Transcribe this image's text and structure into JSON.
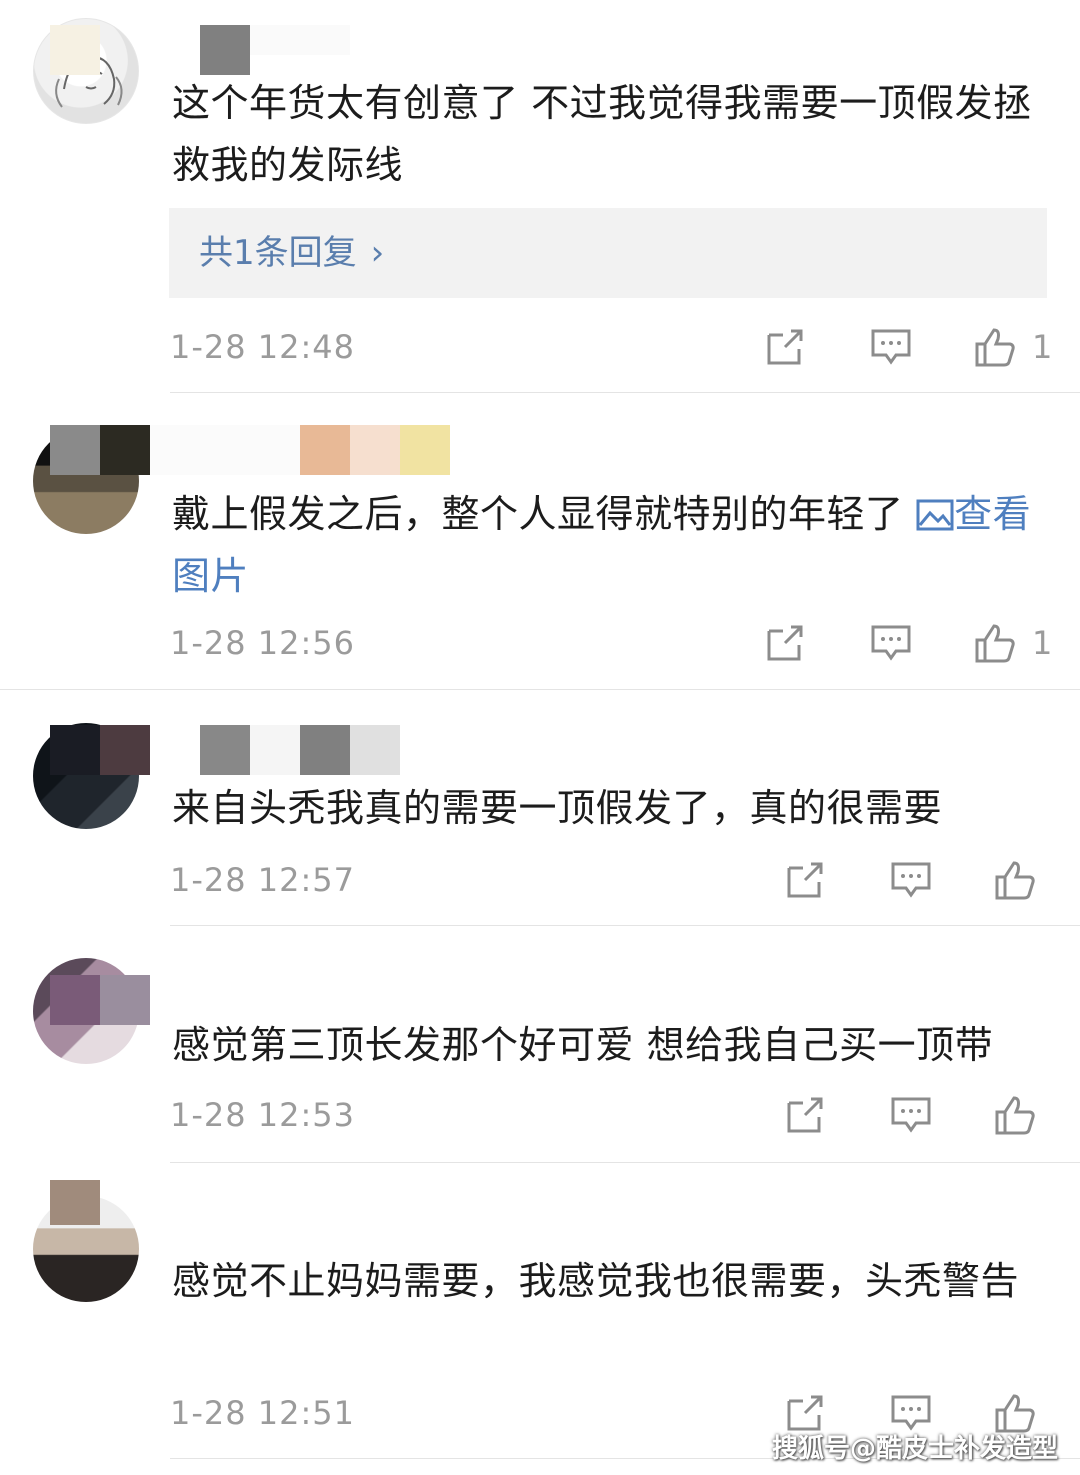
{
  "comments": [
    {
      "text": "这个年货太有创意了 不过我觉得我需要一顶假发拯救我的发际线",
      "reply_summary": "共1条回复",
      "time": "1-28 12:48",
      "likes": "1"
    },
    {
      "text": "戴上假发之后，整个人显得就特别的年轻了 ",
      "view_picture": "查看图片",
      "time": "1-28 12:56",
      "likes": "1"
    },
    {
      "text": "来自头秃我真的需要一顶假发了，真的很需要",
      "time": "1-28 12:57",
      "likes": ""
    },
    {
      "text": "感觉第三顶长发那个好可爱 想给我自己买一顶带",
      "time": "1-28 12:53",
      "likes": ""
    },
    {
      "text": "感觉不止妈妈需要，我感觉我也很需要，头秃警告",
      "time": "1-28 12:51",
      "likes": ""
    }
  ],
  "icons": {
    "share": "share-icon",
    "comment": "comment-icon",
    "like": "thumbs-up-icon",
    "picture": "picture-icon"
  },
  "colors": {
    "link": "#4f7fbf",
    "meta": "#9b9b9b",
    "reply_bg": "#f2f2f2"
  },
  "watermark": "搜狐号@酷皮士补发造型"
}
